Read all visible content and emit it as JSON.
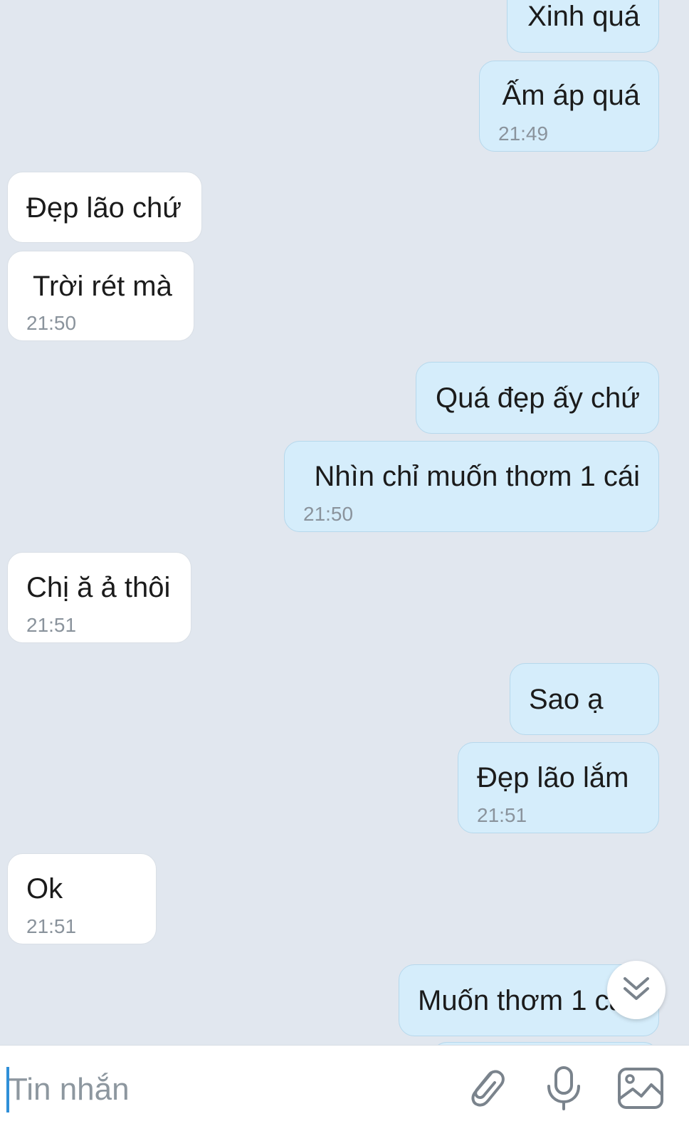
{
  "messages": [
    {
      "text": "Xinh quá",
      "time": ""
    },
    {
      "text": "Ấm áp quá",
      "time": "21:49"
    },
    {
      "text": "Đẹp lão chứ",
      "time": ""
    },
    {
      "text": "Trời rét mà",
      "time": "21:50"
    },
    {
      "text": "Quá đẹp ấy chứ",
      "time": ""
    },
    {
      "text": "Nhìn chỉ muốn thơm 1 cái",
      "time": "21:50"
    },
    {
      "text": "Chị ă ả thôi",
      "time": "21:51"
    },
    {
      "text": "Sao ạ",
      "time": ""
    },
    {
      "text": "Đẹp lão lắm",
      "time": "21:51"
    },
    {
      "text": "Ok",
      "time": "21:51"
    },
    {
      "text": "Muốn thơm 1 cái",
      "time": ""
    }
  ],
  "composer": {
    "placeholder": "Tin nhắn",
    "value": ""
  },
  "icons": {
    "scroll_down": "double-chevron-down-icon",
    "attach": "paperclip-icon",
    "voice": "microphone-icon",
    "gallery": "image-icon"
  },
  "colors": {
    "background": "#e1e7ef",
    "outgoing_bubble": "#d5edfb",
    "incoming_bubble": "#ffffff",
    "timestamp": "#8a939c",
    "placeholder": "#8d979f",
    "caret": "#2f8fd8",
    "icon": "#7a838c"
  }
}
